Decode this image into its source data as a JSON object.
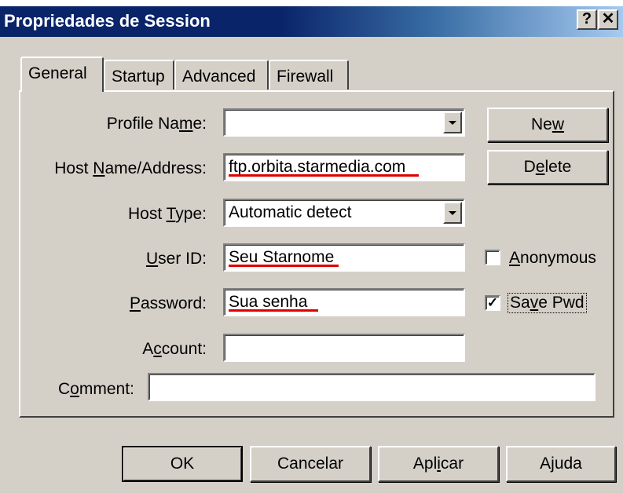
{
  "window": {
    "title": "Propriedades de Session",
    "help_glyph": "?",
    "close_glyph": "✕",
    "titlebar_colors": [
      "#0a246a",
      "#a6caf0"
    ]
  },
  "tabs": [
    {
      "label": "General",
      "active": true
    },
    {
      "label": "Startup",
      "active": false
    },
    {
      "label": "Advanced",
      "active": false
    },
    {
      "label": "Firewall",
      "active": false
    }
  ],
  "form": {
    "profile_name": {
      "label_pre": "Profile Na",
      "label_ul": "m",
      "label_post": "e:",
      "value": ""
    },
    "host_name": {
      "label_pre": "Host ",
      "label_ul": "N",
      "label_post": "ame/Address:",
      "value": "ftp.orbita.starmedia.com"
    },
    "host_type": {
      "label_pre": "Host ",
      "label_ul": "T",
      "label_post": "ype:",
      "value": "Automatic detect"
    },
    "user_id": {
      "label_pre": "",
      "label_ul": "U",
      "label_post": "ser ID:",
      "value": "Seu Starnome"
    },
    "password": {
      "label_pre": "",
      "label_ul": "P",
      "label_post": "assword:",
      "value": "Sua senha"
    },
    "account": {
      "label_pre": "A",
      "label_ul": "c",
      "label_post": "count:",
      "value": ""
    },
    "comment": {
      "label_pre": "C",
      "label_ul": "o",
      "label_post": "mment:",
      "value": ""
    }
  },
  "side_buttons": {
    "new": {
      "pre": "Ne",
      "ul": "w",
      "post": ""
    },
    "delete": {
      "pre": "D",
      "ul": "e",
      "post": "lete"
    }
  },
  "checkboxes": {
    "anonymous": {
      "pre": "",
      "ul": "A",
      "post": "nonymous",
      "checked": false,
      "glyph": ""
    },
    "save_pwd": {
      "pre": "Sa",
      "ul": "v",
      "post": "e Pwd",
      "checked": true,
      "glyph": "✓"
    }
  },
  "footer_buttons": {
    "ok": "OK",
    "cancel": "Cancelar",
    "apply_pre": "Apl",
    "apply_ul": "i",
    "apply_post": "car",
    "help": "Ajuda"
  },
  "annotation_color": "#e00000"
}
